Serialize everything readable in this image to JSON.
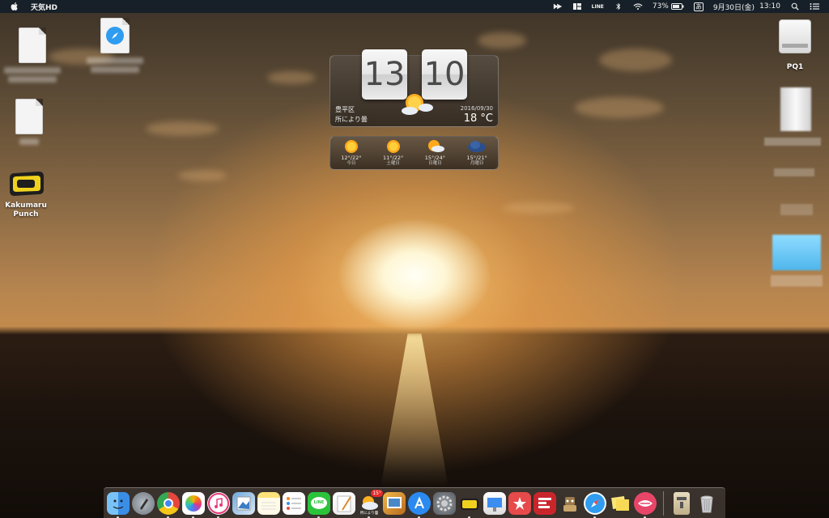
{
  "menubar": {
    "app_name": "天気HD",
    "battery": "73%",
    "ime": "あ",
    "date": "9月30日(金)",
    "time": "13:10",
    "icons": [
      "apple-icon",
      "hd-icon",
      "panels-icon",
      "line-icon",
      "bluetooth-icon",
      "wifi-icon",
      "battery-icon",
      "input-method-icon",
      "spotlight-icon",
      "notification-center-icon"
    ],
    "line_label": "LINE"
  },
  "desktop": {
    "icons": [
      {
        "name": "document-1",
        "label": ""
      },
      {
        "name": "safari-webloc",
        "label": ""
      },
      {
        "name": "document-2",
        "label": ""
      },
      {
        "name": "kakumaru-punch",
        "label": "Kakumaru\nPunch"
      },
      {
        "name": "drive-pq1",
        "label": "PQ1"
      }
    ],
    "kakumaru_line1": "Kakumaru",
    "kakumaru_line2": "Punch",
    "drive_label": "PQ1"
  },
  "weather_widget": {
    "hour": "13",
    "minute": "10",
    "location": "豊平区",
    "condition": "所により曇",
    "date": "2016/09/30",
    "temperature": "18 °C",
    "forecast": [
      {
        "temp": "12°/22°",
        "label": "今日",
        "icon": "sunny-icon"
      },
      {
        "temp": "11°/22°",
        "label": "土曜日",
        "icon": "sunny-icon"
      },
      {
        "temp": "15°/24°",
        "label": "日曜日",
        "icon": "partly-cloudy-icon"
      },
      {
        "temp": "15°/21°",
        "label": "月曜日",
        "icon": "cloudy-icon"
      }
    ]
  },
  "dock": {
    "apps": [
      "finder",
      "launchpad",
      "chrome",
      "photos",
      "itunes",
      "preview",
      "notes",
      "reminders",
      "line",
      "textedit",
      "weather-hd",
      "photo-slideshow",
      "app-store",
      "system-preferences",
      "kakumaru-punch",
      "keynote",
      "reeder",
      "pdf-tool",
      "automator",
      "safari",
      "stickies",
      "airmail",
      "archive-utility",
      "trash"
    ],
    "weather_badge": "15°",
    "weather_label": "所により曇",
    "line_label": "LINE",
    "colors": {
      "finder": "#3a8ee6",
      "chrome": "#e8453c",
      "line": "#2ac33a",
      "app_store": "#2a8af0",
      "safari": "#2f9cf0"
    }
  }
}
